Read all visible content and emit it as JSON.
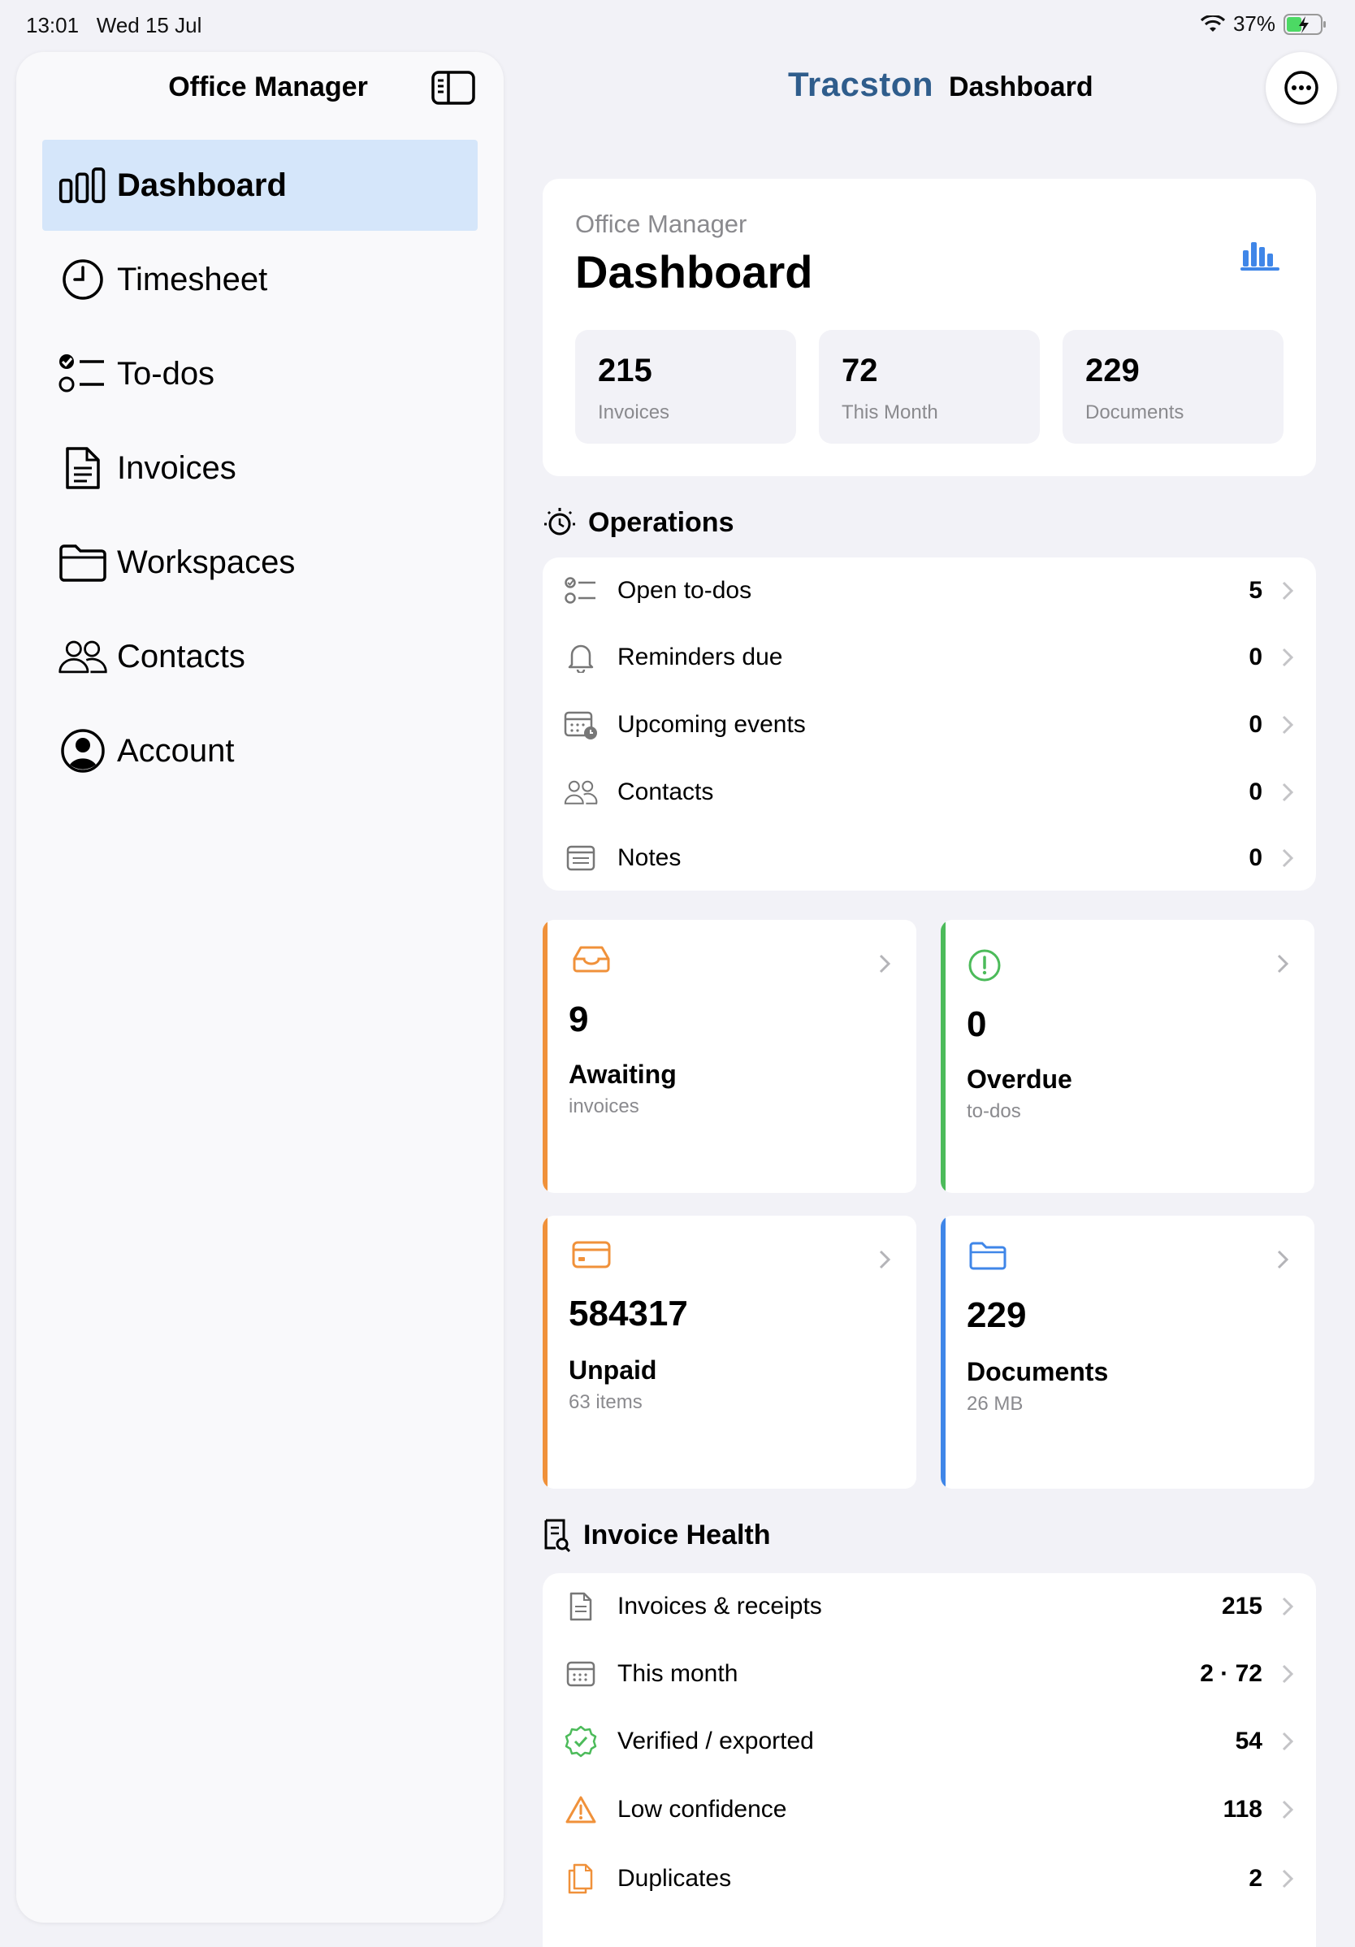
{
  "status": {
    "time": "13:01",
    "date": "Wed 15 Jul",
    "battery": "37%"
  },
  "sidebar": {
    "title": "Office Manager",
    "items": [
      {
        "label": "Dashboard",
        "icon": "bar-chart-icon",
        "active": true
      },
      {
        "label": "Timesheet",
        "icon": "clock-icon"
      },
      {
        "label": "To-dos",
        "icon": "checklist-icon"
      },
      {
        "label": "Invoices",
        "icon": "document-icon"
      },
      {
        "label": "Workspaces",
        "icon": "folder-icon"
      },
      {
        "label": "Contacts",
        "icon": "people-icon"
      },
      {
        "label": "Account",
        "icon": "person-circle-icon"
      }
    ]
  },
  "header": {
    "brand": "Tracston",
    "title": "Dashboard"
  },
  "dashboard": {
    "subtitle": "Office Manager",
    "title": "Dashboard",
    "stats": [
      {
        "value": "215",
        "label": "Invoices"
      },
      {
        "value": "72",
        "label": "This Month"
      },
      {
        "value": "229",
        "label": "Documents"
      }
    ]
  },
  "operations": {
    "heading": "Operations",
    "rows": [
      {
        "label": "Open to-dos",
        "value": "5",
        "icon": "checklist-icon"
      },
      {
        "label": "Reminders due",
        "value": "0",
        "icon": "bell-icon"
      },
      {
        "label": "Upcoming events",
        "value": "0",
        "icon": "calendar-clock-icon"
      },
      {
        "label": "Contacts",
        "value": "0",
        "icon": "people-icon"
      },
      {
        "label": "Notes",
        "value": "0",
        "icon": "note-icon"
      }
    ]
  },
  "tiles": [
    {
      "value": "9",
      "label": "Awaiting",
      "sub": "invoices",
      "color": "#f0913a",
      "icon": "inbox-icon"
    },
    {
      "value": "0",
      "label": "Overdue",
      "sub": "to-dos",
      "color": "#4cbb5a",
      "icon": "exclamation-circle-icon"
    },
    {
      "value": "584317",
      "label": "Unpaid",
      "sub": "63 items",
      "color": "#f0913a",
      "icon": "credit-card-icon"
    },
    {
      "value": "229",
      "label": "Documents",
      "sub": "26 MB",
      "color": "#3f86e8",
      "icon": "folder-icon"
    }
  ],
  "invoice_health": {
    "heading": "Invoice Health",
    "rows": [
      {
        "label": "Invoices & receipts",
        "value": "215",
        "icon": "document-icon"
      },
      {
        "label": "This month",
        "value": "2 · 72",
        "icon": "calendar-icon"
      },
      {
        "label": "Verified / exported",
        "value": "54",
        "icon": "verified-badge-icon"
      },
      {
        "label": "Low confidence",
        "value": "118",
        "icon": "warning-triangle-icon"
      },
      {
        "label": "Duplicates",
        "value": "2",
        "icon": "duplicate-docs-icon"
      }
    ]
  },
  "colors": {
    "accent": "#3f86e8",
    "active_bg": "#d5e6fa",
    "brand": "#2f5d8c",
    "orange": "#f0913a",
    "green": "#4cbb5a"
  }
}
